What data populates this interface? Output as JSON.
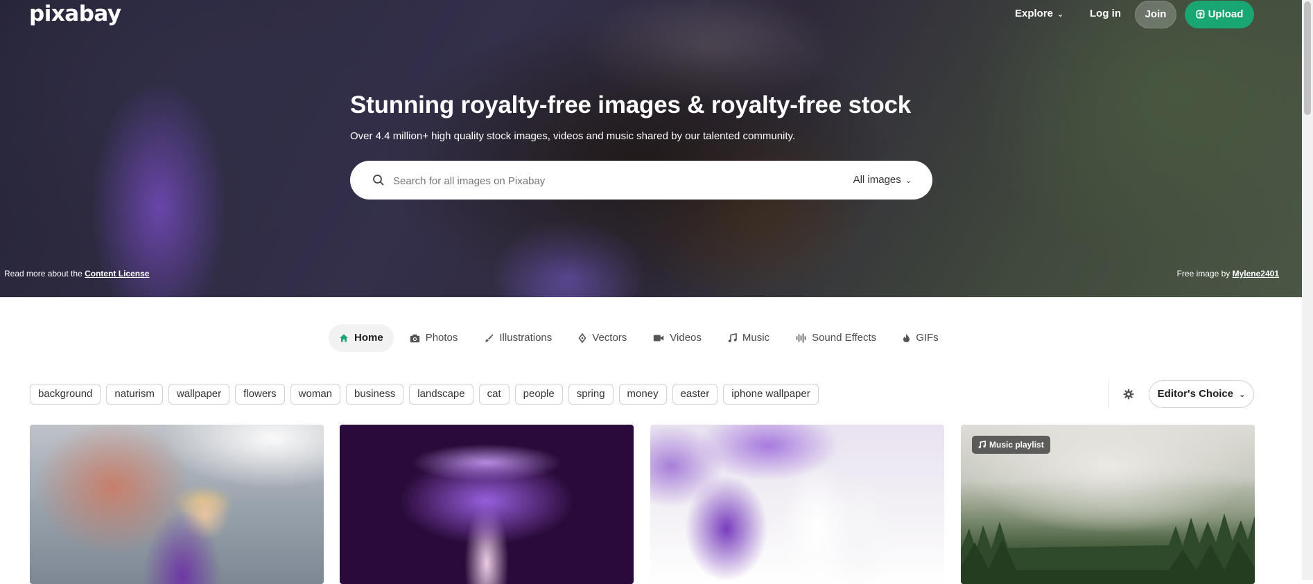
{
  "header": {
    "logo": "pixabay",
    "nav": {
      "explore": "Explore",
      "login": "Log in",
      "join": "Join",
      "upload": "Upload"
    }
  },
  "hero": {
    "title": "Stunning royalty-free images & royalty-free stock",
    "subtitle": "Over 4.4 million+ high quality stock images, videos and music shared by our talented community.",
    "search": {
      "placeholder": "Search for all images on Pixabay",
      "type_selected": "All images"
    },
    "license_prefix": "Read more about the",
    "license_link": "Content License",
    "credit_prefix": "Free image by",
    "credit_author": "Mylene2401"
  },
  "tabs": [
    {
      "label": "Home",
      "icon": "home-icon",
      "active": true
    },
    {
      "label": "Photos",
      "icon": "camera-icon",
      "active": false
    },
    {
      "label": "Illustrations",
      "icon": "brush-icon",
      "active": false
    },
    {
      "label": "Vectors",
      "icon": "pen-nib-icon",
      "active": false
    },
    {
      "label": "Videos",
      "icon": "video-icon",
      "active": false
    },
    {
      "label": "Music",
      "icon": "music-note-icon",
      "active": false
    },
    {
      "label": "Sound Effects",
      "icon": "sound-wave-icon",
      "active": false
    },
    {
      "label": "GIFs",
      "icon": "flame-icon",
      "active": false
    }
  ],
  "tags": [
    "background",
    "naturism",
    "wallpaper",
    "flowers",
    "woman",
    "business",
    "landscape",
    "cat",
    "people",
    "spring",
    "money",
    "easter",
    "iphone wallpaper"
  ],
  "filter": {
    "sort_label": "Editor's Choice"
  },
  "grid": {
    "cards": [
      {
        "description": "woman in purple dress with conical hat"
      },
      {
        "description": "purple glowing mushroom"
      },
      {
        "description": "purple and white crocus flowers"
      },
      {
        "description": "misty forest mountains",
        "badge": "Music playlist"
      }
    ]
  },
  "colors": {
    "accent_green": "#19a672",
    "text_dark": "#1f1f1f",
    "chip_border": "#d0d0d0"
  }
}
